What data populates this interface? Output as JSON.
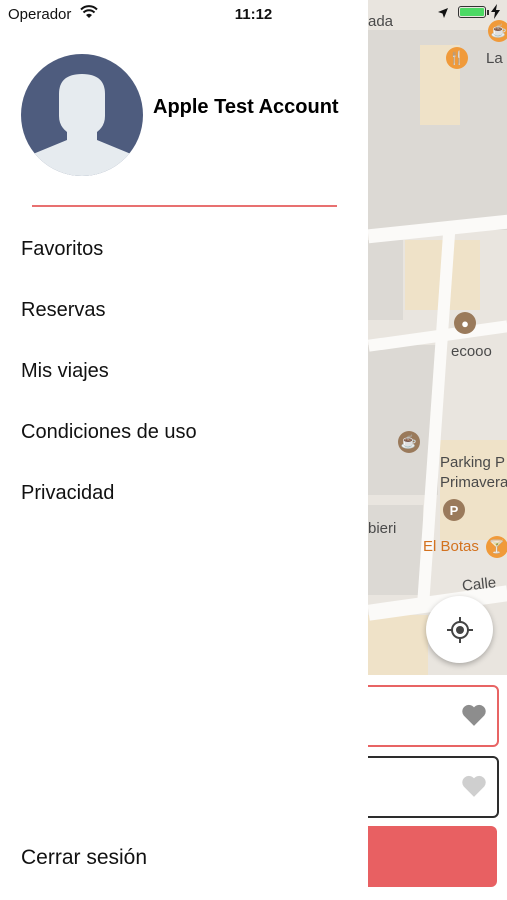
{
  "status_bar": {
    "carrier": "Operador",
    "time": "11:12"
  },
  "drawer": {
    "user_name": "Apple Test Account",
    "menu": [
      {
        "label": "Favoritos"
      },
      {
        "label": "Reservas"
      },
      {
        "label": "Mis viajes"
      },
      {
        "label": "Condiciones de uso"
      },
      {
        "label": "Privacidad"
      }
    ],
    "logout_label": "Cerrar sesión"
  },
  "map": {
    "labels": {
      "top_partial": "ada",
      "restaurant_partial": "La",
      "ecooo": "ecooo",
      "parking_line1": "Parking P",
      "parking_line2": "Primavera",
      "bieri_partial": "bieri",
      "el_botas": "El Botas",
      "calle_partial": "Calle"
    },
    "poi_parking_glyph": "P"
  },
  "colors": {
    "accent": "#e86062",
    "avatar_bg": "#4e5c7e",
    "poi_orange": "#f09a3a"
  }
}
